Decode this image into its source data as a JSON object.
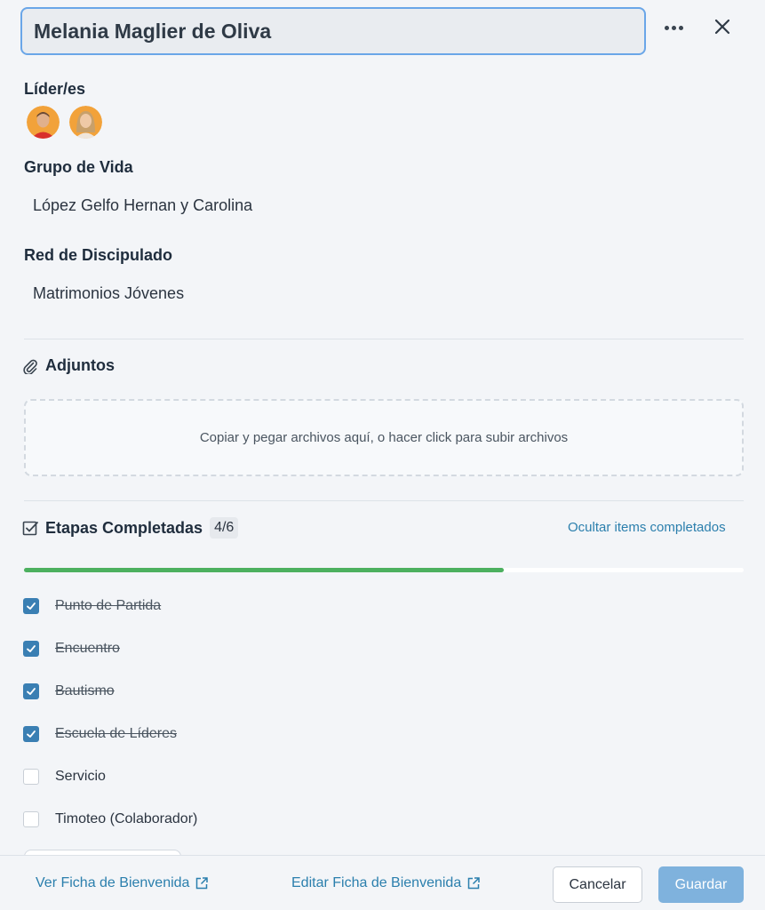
{
  "header": {
    "name_value": "Melania Maglier de Oliva",
    "more_icon": "more-horizontal-icon",
    "close_icon": "close-icon"
  },
  "leaders": {
    "label": "Líder/es",
    "avatars": [
      "avatar-leader-male",
      "avatar-leader-female"
    ]
  },
  "life_group": {
    "label": "Grupo de Vida",
    "value": "López Gelfo Hernan y Carolina"
  },
  "network": {
    "label": "Red de Discipulado",
    "value": "Matrimonios Jóvenes"
  },
  "attachments": {
    "label": "Adjuntos",
    "icon": "paperclip-icon",
    "dropzone_text": "Copiar y pegar archivos aquí, o hacer click para subir archivos"
  },
  "steps": {
    "label": "Etapas Completadas",
    "icon": "checklist-icon",
    "count": "4/6",
    "progress": 0.667,
    "hide_link": "Ocultar items completados",
    "items": [
      {
        "label": "Punto de Partida",
        "checked": true
      },
      {
        "label": "Encuentro",
        "checked": true
      },
      {
        "label": "Bautismo",
        "checked": true
      },
      {
        "label": "Escuela de Líderes",
        "checked": true
      },
      {
        "label": "Servicio",
        "checked": false
      },
      {
        "label": "Timoteo (Colaborador)",
        "checked": false
      }
    ]
  },
  "footer": {
    "view_link": "Ver Ficha de Bienvenida",
    "edit_link": "Editar Ficha de Bienvenida",
    "external_icon": "external-link-icon",
    "cancel_label": "Cancelar",
    "save_label": "Guardar"
  },
  "colors": {
    "accent": "#2b7fad",
    "checkbox_checked": "#3a7fb3",
    "progress": "#4cb05f",
    "save_button": "#7fb2dd",
    "input_border": "#6aa6e8"
  }
}
